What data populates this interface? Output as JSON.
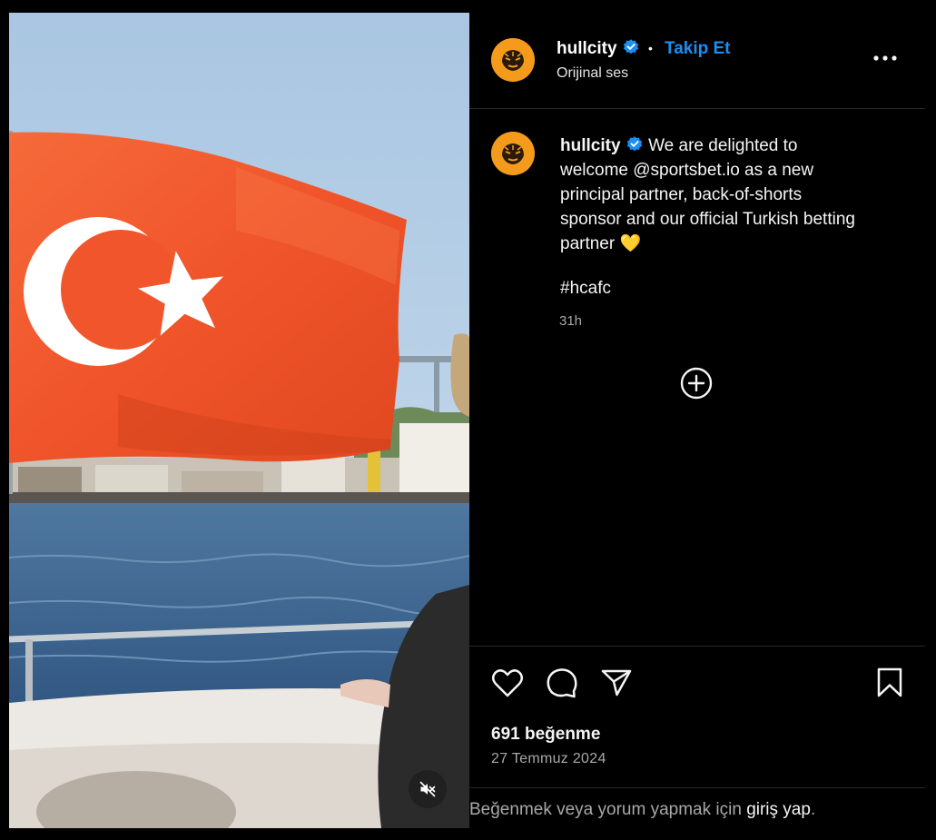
{
  "header": {
    "username": "hullcity",
    "separator": "•",
    "follow_label": "Takip Et",
    "audio_label": "Orijinal ses"
  },
  "caption": {
    "username": "hullcity",
    "text": "We are delighted to welcome @sportsbet.io as a new principal partner, back-of-shorts sponsor and our official Turkish betting partner 💛",
    "hashtag": "#hcafc",
    "time": "31h"
  },
  "stats": {
    "likes": "691 beğenme",
    "date": "27 Temmuz 2024"
  },
  "footer": {
    "prompt": "Beğenmek veya yorum yapmak için ",
    "link": "giriş yap",
    "end": "."
  },
  "icons": {
    "more": "more-options-icon",
    "like": "heart-icon",
    "comment": "comment-icon",
    "share": "share-icon",
    "save": "bookmark-icon",
    "load_more": "plus-circle-icon",
    "mute": "muted-speaker-icon",
    "verified": "verified-badge-icon"
  },
  "colors": {
    "background": "#000000",
    "accent": "#1a8ff2",
    "avatar": "#f59b1b",
    "flag": "#f2562a"
  }
}
